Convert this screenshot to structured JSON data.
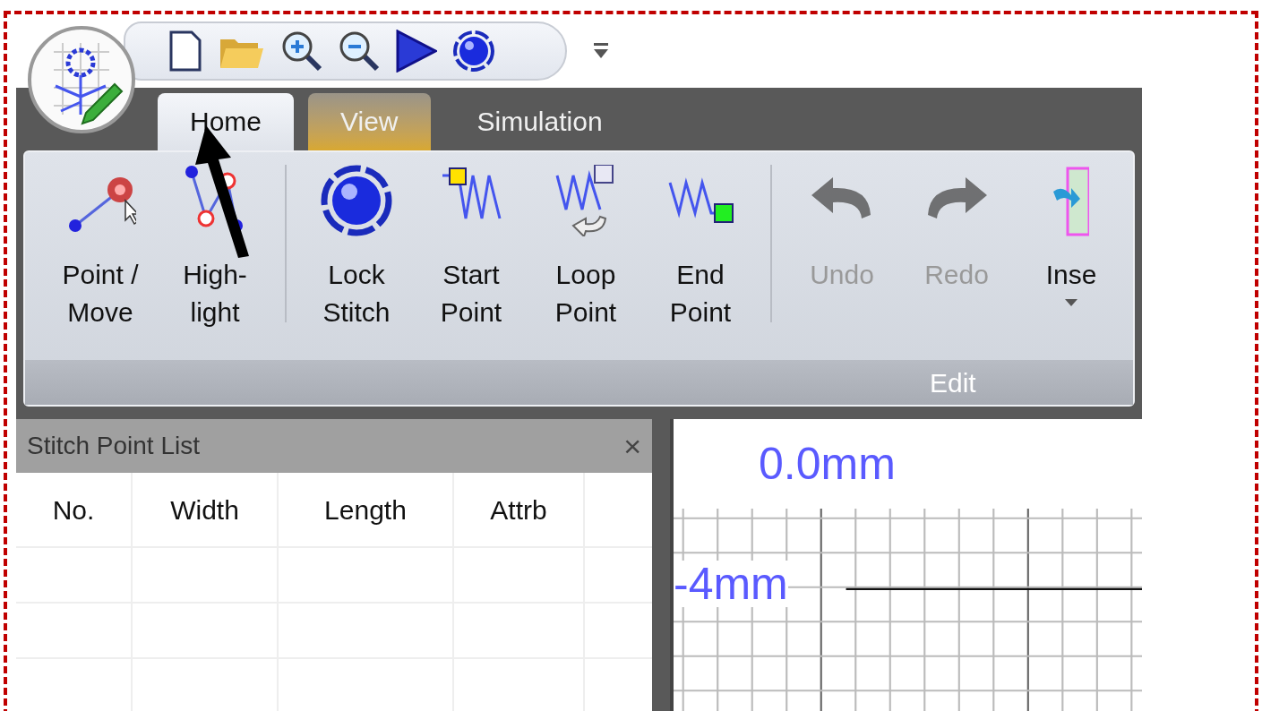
{
  "tabs": [
    {
      "label": "Home",
      "selected": true,
      "hovered": false
    },
    {
      "label": "View",
      "selected": false,
      "hovered": true
    },
    {
      "label": "Simulation",
      "selected": false,
      "hovered": false
    }
  ],
  "ribbon": {
    "sections": [
      [
        {
          "kind": "point-move",
          "label": "Point /\nMove",
          "disabled": false
        },
        {
          "kind": "highlight",
          "label": "High-\nlight",
          "disabled": false
        }
      ],
      [
        {
          "kind": "lock-stitch",
          "label": "Lock\nStitch",
          "disabled": false
        },
        {
          "kind": "start-point",
          "label": "Start\nPoint",
          "disabled": false
        },
        {
          "kind": "loop-point",
          "label": "Loop\nPoint",
          "disabled": false
        },
        {
          "kind": "end-point",
          "label": "End\nPoint",
          "disabled": false
        }
      ],
      [
        {
          "kind": "undo",
          "label": "Undo",
          "disabled": true
        },
        {
          "kind": "redo",
          "label": "Redo",
          "disabled": true
        },
        {
          "kind": "insert",
          "label": "Inse",
          "disabled": false,
          "dropdown": true
        }
      ]
    ],
    "group_label": "Edit"
  },
  "stitch_panel": {
    "title": "Stitch Point List",
    "close": "×",
    "columns": [
      "No.",
      "Width",
      "Length",
      "Attrb"
    ]
  },
  "canvas": {
    "top_label": "0.0mm",
    "ruler_label": "-4mm"
  }
}
